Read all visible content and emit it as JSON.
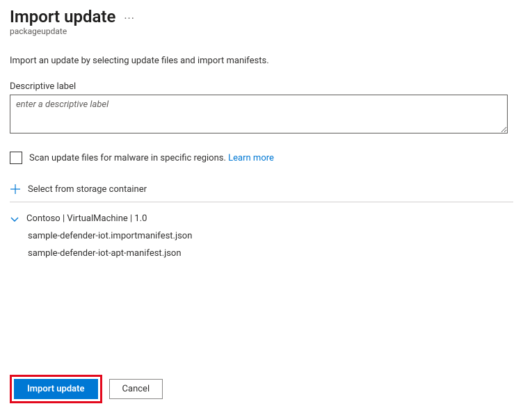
{
  "header": {
    "title": "Import update",
    "subtitle": "packageupdate"
  },
  "intro": "Import an update by selecting update files and import manifests.",
  "descriptive": {
    "label": "Descriptive label",
    "placeholder": "enter a descriptive label",
    "value": ""
  },
  "malware": {
    "label": "Scan update files for malware in specific regions. ",
    "learn_more": "Learn more"
  },
  "storage": {
    "select_label": "Select from storage container"
  },
  "update_group": {
    "title": "Contoso | VirtualMachine | 1.0",
    "files": [
      "sample-defender-iot.importmanifest.json",
      "sample-defender-iot-apt-manifest.json"
    ]
  },
  "footer": {
    "import_label": "Import update",
    "cancel_label": "Cancel"
  }
}
